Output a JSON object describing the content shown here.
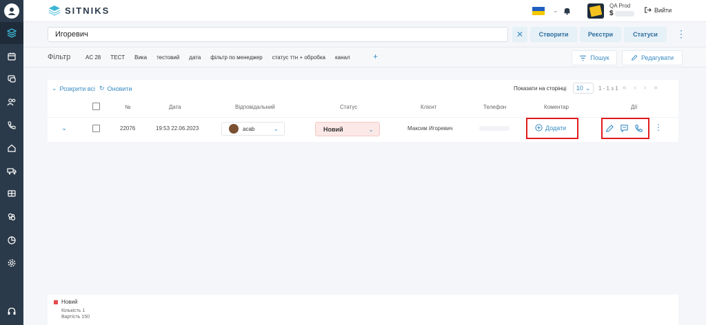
{
  "brand": {
    "name": "SITNIKS"
  },
  "account": {
    "name": "QA Prod",
    "balance": "$"
  },
  "header": {
    "logout_label": "Вийти"
  },
  "search": {
    "value": "Игоревич",
    "clear": "✕"
  },
  "toolbar": {
    "create_label": "Створити",
    "registers_label": "Реєстри",
    "statuses_label": "Статуси",
    "more": "⋮"
  },
  "filter": {
    "label": "Фільтр",
    "chips": [
      "AC 28",
      "TECT",
      "Вика",
      "тестовий",
      "дата",
      "фільтр по менеджер",
      "статус ттн + обробка",
      "канал"
    ],
    "add": "+",
    "search_label": "Пошук",
    "edit_label": "Редагувати"
  },
  "table": {
    "expand_all": "Розкрити всі",
    "refresh": "Оновити",
    "per_page_label": "Показати на сторінці",
    "per_page": "10",
    "range": "1 - 1 з 1",
    "pager": [
      "«",
      "‹",
      "›",
      "»"
    ],
    "headers": {
      "number": "№",
      "date": "Дата",
      "responsible": "Відповідальний",
      "status": "Статус",
      "client": "Клієнт",
      "phone": "Телефон",
      "comment": "Коментар",
      "actions": "Дії"
    },
    "rows": [
      {
        "number": "22076",
        "date": "19:53 22.06.2023",
        "responsible": "acab",
        "status": "Новий",
        "client": "Максим Игоревич",
        "comment_add": "Додати"
      }
    ]
  },
  "summary": {
    "status": "Новий",
    "count": "Кількість 1",
    "cost": "Вартість 150"
  },
  "colors": {
    "sidebar": "#2b3a4a",
    "accent": "#3b8cc4",
    "highlight": "#e11b1b",
    "status_bg": "#fce9e7"
  }
}
